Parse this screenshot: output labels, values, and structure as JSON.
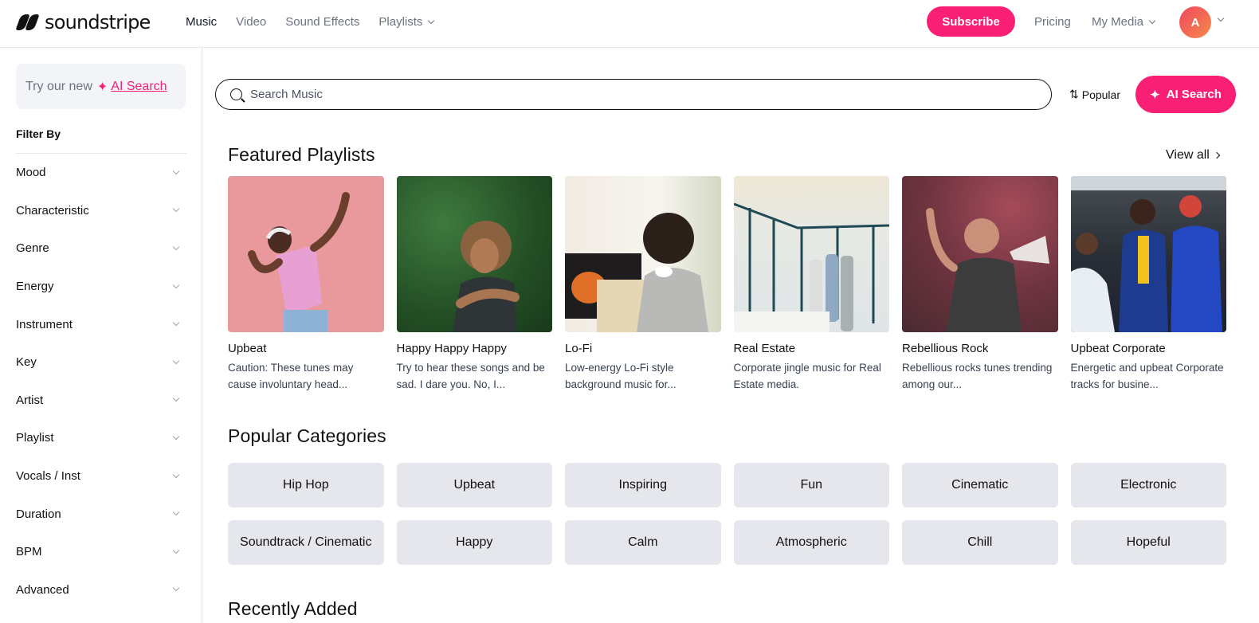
{
  "brand": {
    "name": "soundstripe",
    "accent_color": "#f81f75"
  },
  "topnav": {
    "links": [
      {
        "label": "Music",
        "active": true
      },
      {
        "label": "Video",
        "active": false
      },
      {
        "label": "Sound Effects",
        "active": false
      },
      {
        "label": "Playlists",
        "active": false,
        "has_dropdown": true
      }
    ],
    "subscribe_label": "Subscribe",
    "pricing_label": "Pricing",
    "my_media_label": "My Media",
    "avatar_initial": "A"
  },
  "sidebar": {
    "promo_text": "Try our new",
    "promo_link": "AI Search",
    "filter_title": "Filter By",
    "filters": [
      {
        "label": "Mood"
      },
      {
        "label": "Characteristic"
      },
      {
        "label": "Genre"
      },
      {
        "label": "Energy"
      },
      {
        "label": "Instrument"
      },
      {
        "label": "Key"
      },
      {
        "label": "Artist"
      },
      {
        "label": "Playlist"
      },
      {
        "label": "Vocals / Inst"
      },
      {
        "label": "Duration"
      },
      {
        "label": "BPM"
      },
      {
        "label": "Advanced"
      }
    ]
  },
  "search": {
    "placeholder": "Search Music",
    "value": "",
    "sort_label": "Popular",
    "ai_button_label": "AI Search"
  },
  "featured": {
    "title": "Featured Playlists",
    "view_all_label": "View all",
    "playlists": [
      {
        "name": "Upbeat",
        "description": "Caution: These tunes may cause involuntary head...",
        "image": "girl-dancing-with-headphones-pink-background"
      },
      {
        "name": "Happy Happy Happy",
        "description": "Try to hear these songs and be sad. I dare you. No, I...",
        "image": "woman-smiling-green-hedge"
      },
      {
        "name": "Lo-Fi",
        "description": "Low-energy Lo-Fi style background music for...",
        "image": "woman-reading-with-coffee-by-fireplace"
      },
      {
        "name": "Real Estate",
        "description": "Corporate jingle music for Real Estate media.",
        "image": "people-touring-bright-room"
      },
      {
        "name": "Rebellious Rock",
        "description": "Rebellious rocks tunes trending among our...",
        "image": "man-shouting-into-megaphone"
      },
      {
        "name": "Upbeat Corporate",
        "description": "Energetic and upbeat Corporate tracks for busine...",
        "image": "coworkers-laughing-in-office"
      }
    ]
  },
  "popular": {
    "title": "Popular Categories",
    "categories": [
      "Hip Hop",
      "Upbeat",
      "Inspiring",
      "Fun",
      "Cinematic",
      "Electronic",
      "Soundtrack / Cinematic",
      "Happy",
      "Calm",
      "Atmospheric",
      "Chill",
      "Hopeful"
    ]
  },
  "recent": {
    "title": "Recently Added"
  }
}
